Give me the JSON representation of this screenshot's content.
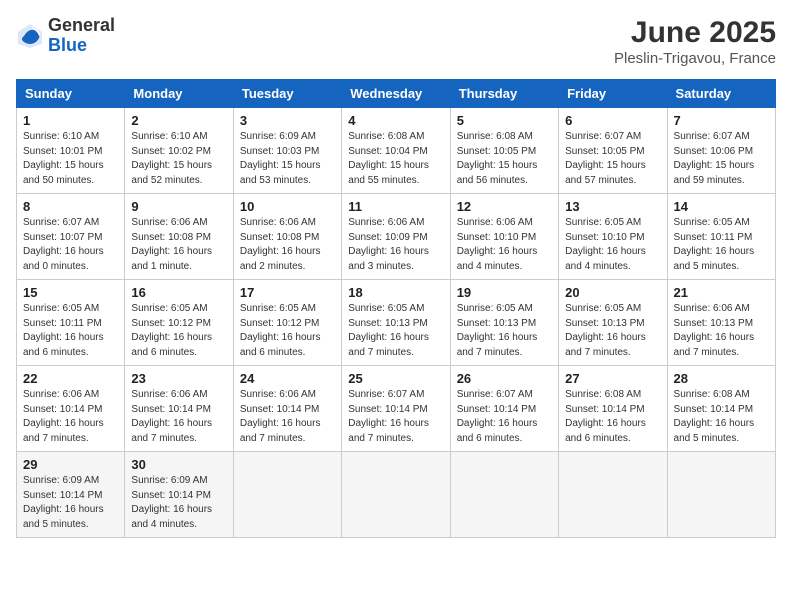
{
  "logo": {
    "general": "General",
    "blue": "Blue"
  },
  "title": "June 2025",
  "subtitle": "Pleslin-Trigavou, France",
  "headers": [
    "Sunday",
    "Monday",
    "Tuesday",
    "Wednesday",
    "Thursday",
    "Friday",
    "Saturday"
  ],
  "weeks": [
    [
      {
        "day": "1",
        "info": "Sunrise: 6:10 AM\nSunset: 10:01 PM\nDaylight: 15 hours\nand 50 minutes."
      },
      {
        "day": "2",
        "info": "Sunrise: 6:10 AM\nSunset: 10:02 PM\nDaylight: 15 hours\nand 52 minutes."
      },
      {
        "day": "3",
        "info": "Sunrise: 6:09 AM\nSunset: 10:03 PM\nDaylight: 15 hours\nand 53 minutes."
      },
      {
        "day": "4",
        "info": "Sunrise: 6:08 AM\nSunset: 10:04 PM\nDaylight: 15 hours\nand 55 minutes."
      },
      {
        "day": "5",
        "info": "Sunrise: 6:08 AM\nSunset: 10:05 PM\nDaylight: 15 hours\nand 56 minutes."
      },
      {
        "day": "6",
        "info": "Sunrise: 6:07 AM\nSunset: 10:05 PM\nDaylight: 15 hours\nand 57 minutes."
      },
      {
        "day": "7",
        "info": "Sunrise: 6:07 AM\nSunset: 10:06 PM\nDaylight: 15 hours\nand 59 minutes."
      }
    ],
    [
      {
        "day": "8",
        "info": "Sunrise: 6:07 AM\nSunset: 10:07 PM\nDaylight: 16 hours\nand 0 minutes."
      },
      {
        "day": "9",
        "info": "Sunrise: 6:06 AM\nSunset: 10:08 PM\nDaylight: 16 hours\nand 1 minute."
      },
      {
        "day": "10",
        "info": "Sunrise: 6:06 AM\nSunset: 10:08 PM\nDaylight: 16 hours\nand 2 minutes."
      },
      {
        "day": "11",
        "info": "Sunrise: 6:06 AM\nSunset: 10:09 PM\nDaylight: 16 hours\nand 3 minutes."
      },
      {
        "day": "12",
        "info": "Sunrise: 6:06 AM\nSunset: 10:10 PM\nDaylight: 16 hours\nand 4 minutes."
      },
      {
        "day": "13",
        "info": "Sunrise: 6:05 AM\nSunset: 10:10 PM\nDaylight: 16 hours\nand 4 minutes."
      },
      {
        "day": "14",
        "info": "Sunrise: 6:05 AM\nSunset: 10:11 PM\nDaylight: 16 hours\nand 5 minutes."
      }
    ],
    [
      {
        "day": "15",
        "info": "Sunrise: 6:05 AM\nSunset: 10:11 PM\nDaylight: 16 hours\nand 6 minutes."
      },
      {
        "day": "16",
        "info": "Sunrise: 6:05 AM\nSunset: 10:12 PM\nDaylight: 16 hours\nand 6 minutes."
      },
      {
        "day": "17",
        "info": "Sunrise: 6:05 AM\nSunset: 10:12 PM\nDaylight: 16 hours\nand 6 minutes."
      },
      {
        "day": "18",
        "info": "Sunrise: 6:05 AM\nSunset: 10:13 PM\nDaylight: 16 hours\nand 7 minutes."
      },
      {
        "day": "19",
        "info": "Sunrise: 6:05 AM\nSunset: 10:13 PM\nDaylight: 16 hours\nand 7 minutes."
      },
      {
        "day": "20",
        "info": "Sunrise: 6:05 AM\nSunset: 10:13 PM\nDaylight: 16 hours\nand 7 minutes."
      },
      {
        "day": "21",
        "info": "Sunrise: 6:06 AM\nSunset: 10:13 PM\nDaylight: 16 hours\nand 7 minutes."
      }
    ],
    [
      {
        "day": "22",
        "info": "Sunrise: 6:06 AM\nSunset: 10:14 PM\nDaylight: 16 hours\nand 7 minutes."
      },
      {
        "day": "23",
        "info": "Sunrise: 6:06 AM\nSunset: 10:14 PM\nDaylight: 16 hours\nand 7 minutes."
      },
      {
        "day": "24",
        "info": "Sunrise: 6:06 AM\nSunset: 10:14 PM\nDaylight: 16 hours\nand 7 minutes."
      },
      {
        "day": "25",
        "info": "Sunrise: 6:07 AM\nSunset: 10:14 PM\nDaylight: 16 hours\nand 7 minutes."
      },
      {
        "day": "26",
        "info": "Sunrise: 6:07 AM\nSunset: 10:14 PM\nDaylight: 16 hours\nand 6 minutes."
      },
      {
        "day": "27",
        "info": "Sunrise: 6:08 AM\nSunset: 10:14 PM\nDaylight: 16 hours\nand 6 minutes."
      },
      {
        "day": "28",
        "info": "Sunrise: 6:08 AM\nSunset: 10:14 PM\nDaylight: 16 hours\nand 5 minutes."
      }
    ],
    [
      {
        "day": "29",
        "info": "Sunrise: 6:09 AM\nSunset: 10:14 PM\nDaylight: 16 hours\nand 5 minutes."
      },
      {
        "day": "30",
        "info": "Sunrise: 6:09 AM\nSunset: 10:14 PM\nDaylight: 16 hours\nand 4 minutes."
      },
      {
        "day": "",
        "info": ""
      },
      {
        "day": "",
        "info": ""
      },
      {
        "day": "",
        "info": ""
      },
      {
        "day": "",
        "info": ""
      },
      {
        "day": "",
        "info": ""
      }
    ]
  ]
}
